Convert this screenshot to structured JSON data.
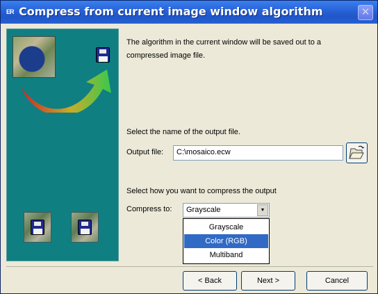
{
  "window": {
    "title": "Compress from current image window algorithm",
    "title_icon": "ER"
  },
  "wizard": {
    "description": "The algorithm in the current window will be saved out to a compressed image file.",
    "output_section_label": "Select the name of the output file.",
    "output_file_label": "Output file:",
    "output_file_value": "C:\\mosaico.ecw",
    "compress_section_label": "Select how you want to compress the output",
    "compress_to_label": "Compress to:",
    "compress_to_value": "Grayscale",
    "compress_options": [
      "Grayscale",
      "Color (RGB)",
      "Multiband"
    ],
    "highlighted_option": "Color (RGB)"
  },
  "buttons": {
    "back": "< Back",
    "next": "Next >",
    "cancel": "Cancel"
  },
  "icons": {
    "title": "app-icon",
    "close": "close-icon",
    "browse": "folder-open-icon",
    "disk": "floppy-disk-icon",
    "arrow": "curved-arrow-icon",
    "dropdown": "chevron-down-icon"
  },
  "colors": {
    "titlebar": "#2a64d8",
    "side_panel": "#0f7f82",
    "selection": "#316ac5",
    "arrow_start": "#d92020",
    "arrow_end": "#3bd04a"
  }
}
